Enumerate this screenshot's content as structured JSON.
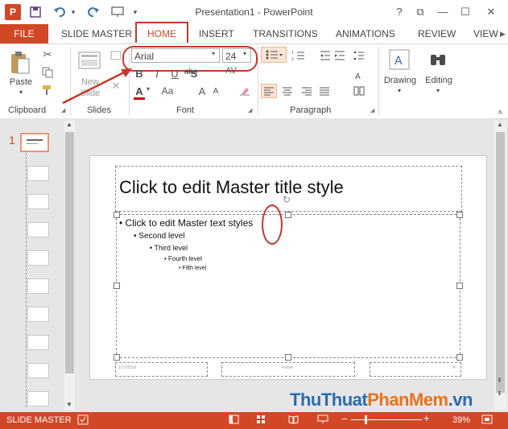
{
  "window": {
    "app_logo": "P",
    "title": "Presentation1 - PowerPoint",
    "controls": {
      "help": "?",
      "restore": "⧉",
      "minimize": "—",
      "maximize": "☐",
      "close": "✕"
    }
  },
  "tabs": {
    "file": "FILE",
    "items": [
      "SLIDE MASTER",
      "HOME",
      "INSERT",
      "TRANSITIONS",
      "ANIMATIONS",
      "REVIEW",
      "VIEW"
    ],
    "active": "HOME"
  },
  "ribbon": {
    "clipboard": {
      "paste_label": "Paste",
      "group_label": "Clipboard"
    },
    "slides": {
      "new_slide_label_1": "New",
      "new_slide_label_2": "Slide",
      "group_label": "Slides"
    },
    "font": {
      "family": "Arial",
      "size": "24",
      "group_label": "Font",
      "bold": "B",
      "italic": "I",
      "underline": "U",
      "strike": "abc",
      "shadow": "S",
      "spacing": "AV",
      "grow": "A",
      "shrink": "A",
      "case": "Aa",
      "color": "A"
    },
    "paragraph": {
      "group_label": "Paragraph"
    },
    "drawing": {
      "label": "Drawing"
    },
    "editing": {
      "label": "Editing"
    }
  },
  "thumbnails": {
    "selected_number": "1",
    "count": 10
  },
  "slide": {
    "title_placeholder": "Click to edit Master title style",
    "levels": [
      "Click to edit Master text styles",
      "Second level",
      "Third level",
      "Fourth level",
      "Fifth level"
    ],
    "bullet": "•",
    "footer_date": "1/27/2016",
    "footer_text": "Footer",
    "footer_number": "‹#›"
  },
  "status": {
    "mode": "SLIDE MASTER",
    "zoom": "39%",
    "zoom_minus": "−",
    "zoom_plus": "+"
  },
  "watermark": {
    "part1": "ThuThuat",
    "part2": "PhanMem",
    "part3": ".vn"
  },
  "colors": {
    "accent": "#d24726",
    "annotation": "#c0392b"
  }
}
